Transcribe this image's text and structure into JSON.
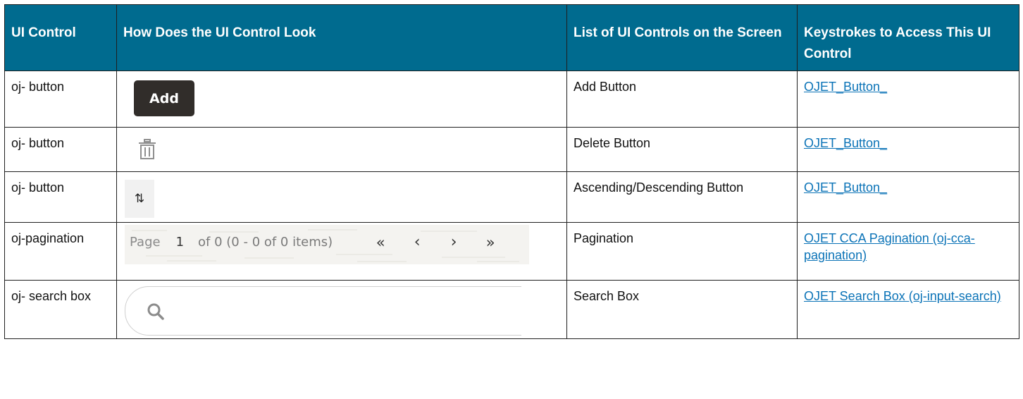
{
  "table": {
    "headers": [
      "UI Control",
      "How Does the UI Control Look",
      "List of UI Controls on the Screen",
      "Keystrokes to Access This UI Control"
    ],
    "rows": [
      {
        "control": "oj- button",
        "list": "Add Button",
        "keystrokes": "OJET_Button_"
      },
      {
        "control": "oj- button",
        "list": "Delete Button",
        "keystrokes": "OJET_Button_"
      },
      {
        "control": "oj- button",
        "list": "Ascending/Descending Button",
        "keystrokes": "OJET_Button_"
      },
      {
        "control": "oj-pagination",
        "list": "Pagination",
        "keystrokes": "OJET CCA Pagination (oj-cca-pagination)"
      },
      {
        "control": "oj- search box",
        "list": "Search Box",
        "keystrokes": "OJET Search Box (oj-input-search)"
      }
    ]
  },
  "samples": {
    "add_button_label": "Add",
    "trash_icon": "trash-icon",
    "sort_glyph": "⇅",
    "pagination": {
      "page_label": "Page",
      "page_number": "1",
      "summary": "of 0 (0 - 0 of 0 items)",
      "first_glyph": "«",
      "prev_glyph": "‹",
      "next_glyph": "›",
      "last_glyph": "»"
    },
    "search_icon": "magnifier-icon"
  },
  "colors": {
    "header_bg": "#006b8f",
    "header_text": "#ffffff",
    "link": "#0b73b7",
    "add_button_bg": "#312d2a"
  }
}
